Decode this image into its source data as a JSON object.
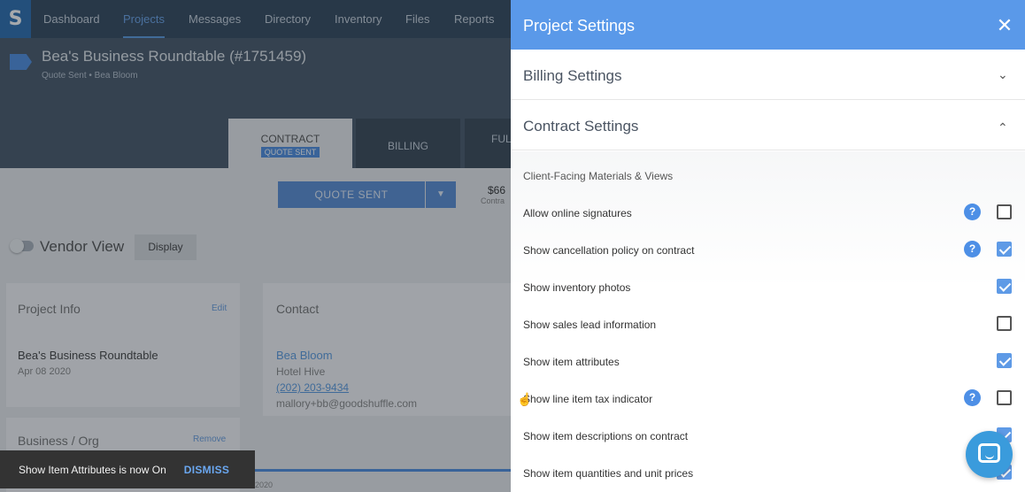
{
  "app": {
    "logo": "S",
    "nav": [
      {
        "label": "Dashboard"
      },
      {
        "label": "Projects"
      },
      {
        "label": "Messages"
      },
      {
        "label": "Directory"
      },
      {
        "label": "Inventory"
      },
      {
        "label": "Files"
      },
      {
        "label": "Reports"
      }
    ],
    "active_nav": "Projects",
    "project_title": "Bea's Business Roundtable (#1751459)",
    "project_subtitle": "Quote Sent • Bea Bloom",
    "tabs": {
      "contract": "CONTRACT",
      "contract_badge": "QUOTE SENT",
      "billing": "BILLING",
      "ful": "FUL"
    },
    "status_button": "QUOTE SENT",
    "amount": "$66",
    "amount_sub": "Contra",
    "vendor_view": "Vendor View",
    "display_button": "Display",
    "project_info": {
      "title": "Project Info",
      "edit": "Edit",
      "name": "Bea's Business Roundtable",
      "date": "Apr 08 2020"
    },
    "contact": {
      "title": "Contact",
      "name": "Bea Bloom",
      "company": "Hotel Hive",
      "phone": "(202) 203-9434",
      "email": "mallory+bb@goodshuffle.com"
    },
    "business": {
      "title": "Business / Org",
      "remove": "Remove"
    },
    "footer_date": "2020"
  },
  "snackbar": {
    "message": "Show Item Attributes is now On",
    "action": "DISMISS"
  },
  "drawer": {
    "title": "Project Settings",
    "sections": {
      "billing": "Billing Settings",
      "contract": "Contract Settings"
    },
    "subheading": "Client-Facing Materials & Views",
    "settings": [
      {
        "label": "Allow online signatures",
        "help": true,
        "checked": false
      },
      {
        "label": "Show cancellation policy on contract",
        "help": true,
        "checked": true
      },
      {
        "label": "Show inventory photos",
        "help": false,
        "checked": true
      },
      {
        "label": "Show sales lead information",
        "help": false,
        "checked": false
      },
      {
        "label": "Show item attributes",
        "help": false,
        "checked": true
      },
      {
        "label": "Show line item tax indicator",
        "help": true,
        "checked": false
      },
      {
        "label": "Show item descriptions on contract",
        "help": false,
        "checked": true
      },
      {
        "label": "Show item quantities and unit prices",
        "help": false,
        "checked": true
      }
    ]
  },
  "colors": {
    "header_blue": "#5a99e9",
    "accent": "#4d8fe6",
    "nav_bg": "#34495e"
  }
}
